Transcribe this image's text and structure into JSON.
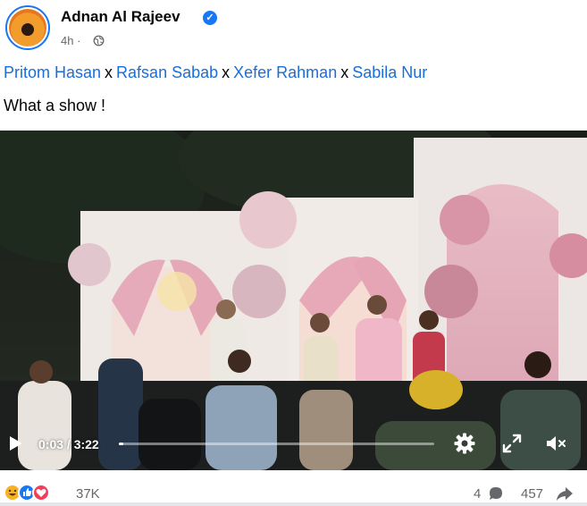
{
  "post": {
    "author": "Adnan Al Rajeev",
    "time": "4h",
    "dot": "·",
    "tags": [
      "Pritom Hasan",
      "Rafsan Sabab",
      "Xefer Rahman",
      "Sabila Nur"
    ],
    "tag_separator": "x",
    "caption": "What a show !"
  },
  "video": {
    "current_time": "0:03",
    "duration": "3:22",
    "time_display": "0:03 / 3:22",
    "progress_fraction": 0.015
  },
  "footer": {
    "reaction_count": "37K",
    "comment_count": "4",
    "share_count": "457"
  },
  "icons": {
    "verified": "verified-badge-icon",
    "audience": "globe-icon",
    "play": "play-icon",
    "settings": "gear-icon",
    "fullscreen": "expand-icon",
    "volume": "mute-icon",
    "comment": "comment-icon",
    "share": "share-icon"
  },
  "colors": {
    "link": "#1b6ed8",
    "verified": "#1877f2",
    "secondary_text": "#65676b",
    "like": "#1877f2",
    "love": "#f33e58",
    "haha": "#f7b125"
  }
}
